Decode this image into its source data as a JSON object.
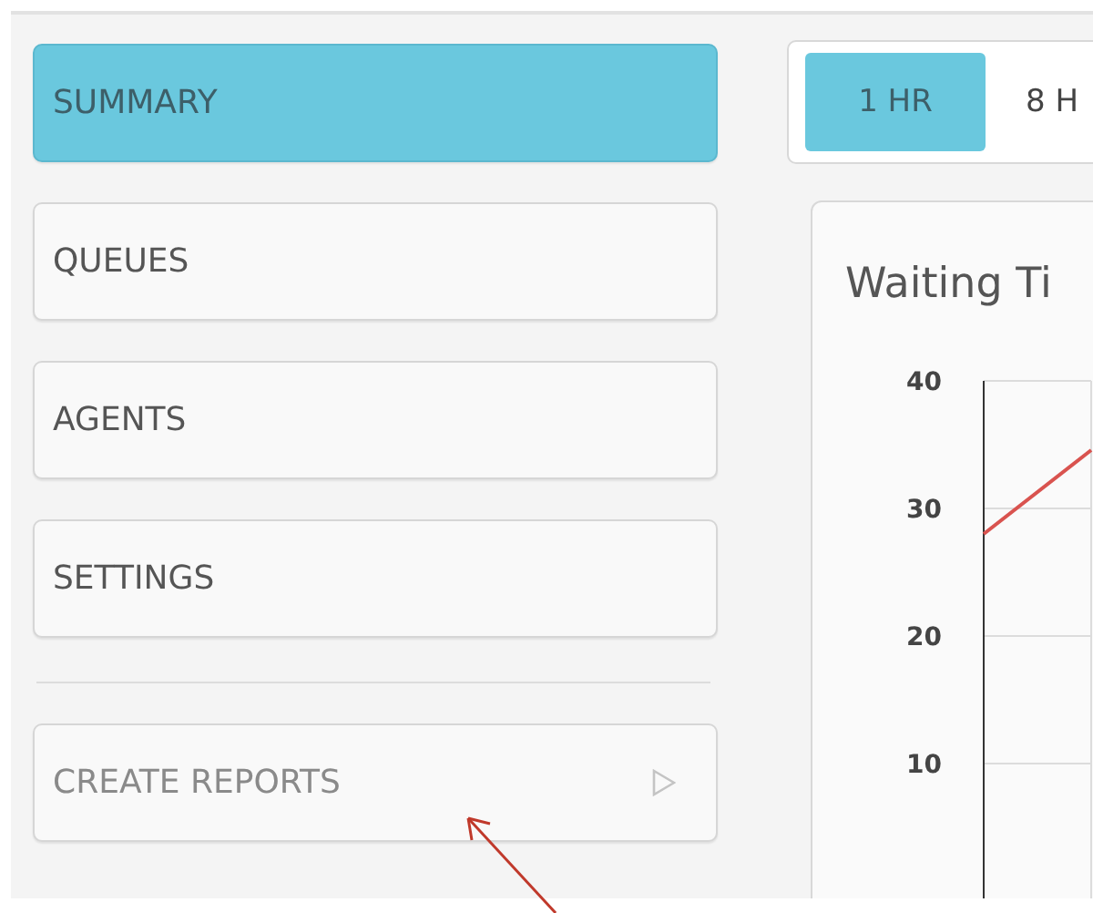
{
  "sidebar": {
    "items": [
      {
        "label": "SUMMARY",
        "selected": true
      },
      {
        "label": "QUEUES",
        "selected": false
      },
      {
        "label": "AGENTS",
        "selected": false
      },
      {
        "label": "SETTINGS",
        "selected": false
      }
    ],
    "action": {
      "label": "CREATE REPORTS"
    }
  },
  "range_tabs": [
    {
      "label": "1 HR",
      "selected": true
    },
    {
      "label": "8 H",
      "selected": false
    }
  ],
  "chart_card": {
    "title": "Waiting Ti",
    "y_axis_labels": [
      "40",
      "30",
      "20",
      "10"
    ]
  }
}
